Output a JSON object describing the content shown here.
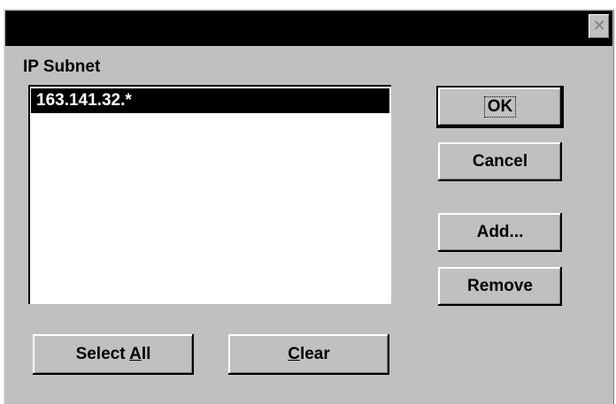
{
  "titlebar": {
    "title": "",
    "close_glyph": "✕"
  },
  "list": {
    "label": "IP Subnet",
    "items": [
      "163.141.32.*"
    ],
    "selected_index": 0
  },
  "buttons": {
    "ok": "OK",
    "cancel": "Cancel",
    "add": "Add...",
    "remove": "Remove",
    "select_all_prefix": "Select ",
    "select_all_mnemonic": "A",
    "select_all_suffix": "ll",
    "clear_mnemonic": "C",
    "clear_suffix": "lear"
  },
  "colors": {
    "face": "#c0c0c0",
    "titlebar": "#000000",
    "selection": "#000000"
  }
}
